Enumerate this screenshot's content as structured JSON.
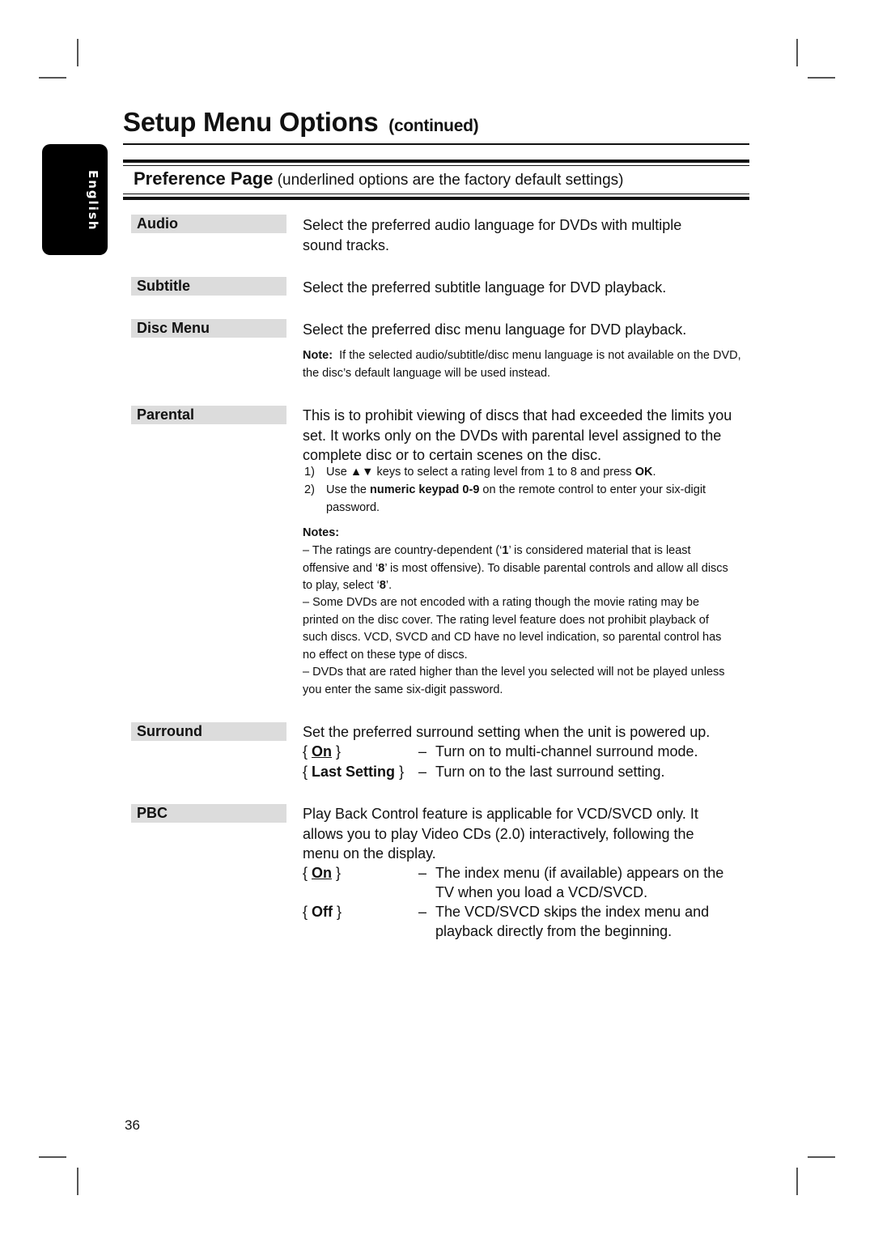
{
  "page": {
    "title": "Setup Menu Options",
    "title_suffix": "(continued)",
    "language_tab": "English",
    "section_title": "Preference Page",
    "section_note": "(underlined options are the factory default settings)",
    "page_number": "36"
  },
  "settings": {
    "audio": {
      "label": "Audio",
      "description": "Select the preferred audio language for DVDs with multiple sound tracks."
    },
    "subtitle": {
      "label": "Subtitle",
      "description": "Select the preferred subtitle language for DVD playback."
    },
    "disc_menu": {
      "label": "Disc Menu",
      "description": "Select the preferred disc menu language for DVD playback.",
      "note_label": "Note:",
      "note_text": "If the selected audio/subtitle/disc menu language is not available on the DVD, the disc’s default language will be used instead."
    },
    "parental": {
      "label": "Parental",
      "description": "This is to prohibit viewing of discs that had exceeded the limits you set. It works only on the DVDs with parental level assigned to the complete disc or to certain scenes on the disc.",
      "steps": [
        {
          "num": "1)",
          "pre": "Use ",
          "icon": "▲▼",
          "mid": " keys to select a rating level from 1 to 8 and press ",
          "bold": "OK",
          "post": "."
        },
        {
          "num": "2)",
          "pre": "Use the ",
          "bold": "numeric keypad 0-9",
          "post": " on the remote control to enter your six-digit password."
        }
      ],
      "notes_label": "Notes:",
      "notes": [
        {
          "a": "–  The ratings are country-dependent (‘",
          "b1": "1",
          "c": "’ is considered material that is least offensive and ‘",
          "b2": "8",
          "d": "’ is most offensive). To disable parental controls and allow all discs to play, select ‘",
          "b3": "8",
          "e": "’."
        },
        {
          "text": "–  Some DVDs are not encoded with a rating though the movie rating may be printed on the disc cover. The rating level feature does not prohibit playback of such discs. VCD, SVCD and CD have no level indication, so parental control has no effect on these type of discs."
        },
        {
          "text": "–  DVDs that are rated higher than the level you selected will not be played unless you enter the same six-digit password."
        }
      ]
    },
    "surround": {
      "label": "Surround",
      "description": "Set the preferred surround setting when the unit is powered up.",
      "options": [
        {
          "name": "On",
          "default": true,
          "dash": "–",
          "text": "Turn on to multi-channel surround mode."
        },
        {
          "name": "Last Setting",
          "default": false,
          "dash": "–",
          "text": "Turn on to the last surround setting."
        }
      ]
    },
    "pbc": {
      "label": "PBC",
      "description": "Play Back Control feature is applicable for VCD/SVCD only. It allows you to play Video CDs (2.0) interactively, following the menu on the display.",
      "options": [
        {
          "name": "On",
          "default": true,
          "dash": "–",
          "text_line1": "The index menu (if available) appears on the",
          "text_line2": "TV when you load a VCD/SVCD."
        },
        {
          "name": "Off",
          "default": false,
          "dash": "–",
          "text_line1": "The VCD/SVCD skips the index menu and",
          "text_line2": "playback directly from the beginning."
        }
      ]
    }
  },
  "brace_open": "{",
  "brace_close": "}"
}
